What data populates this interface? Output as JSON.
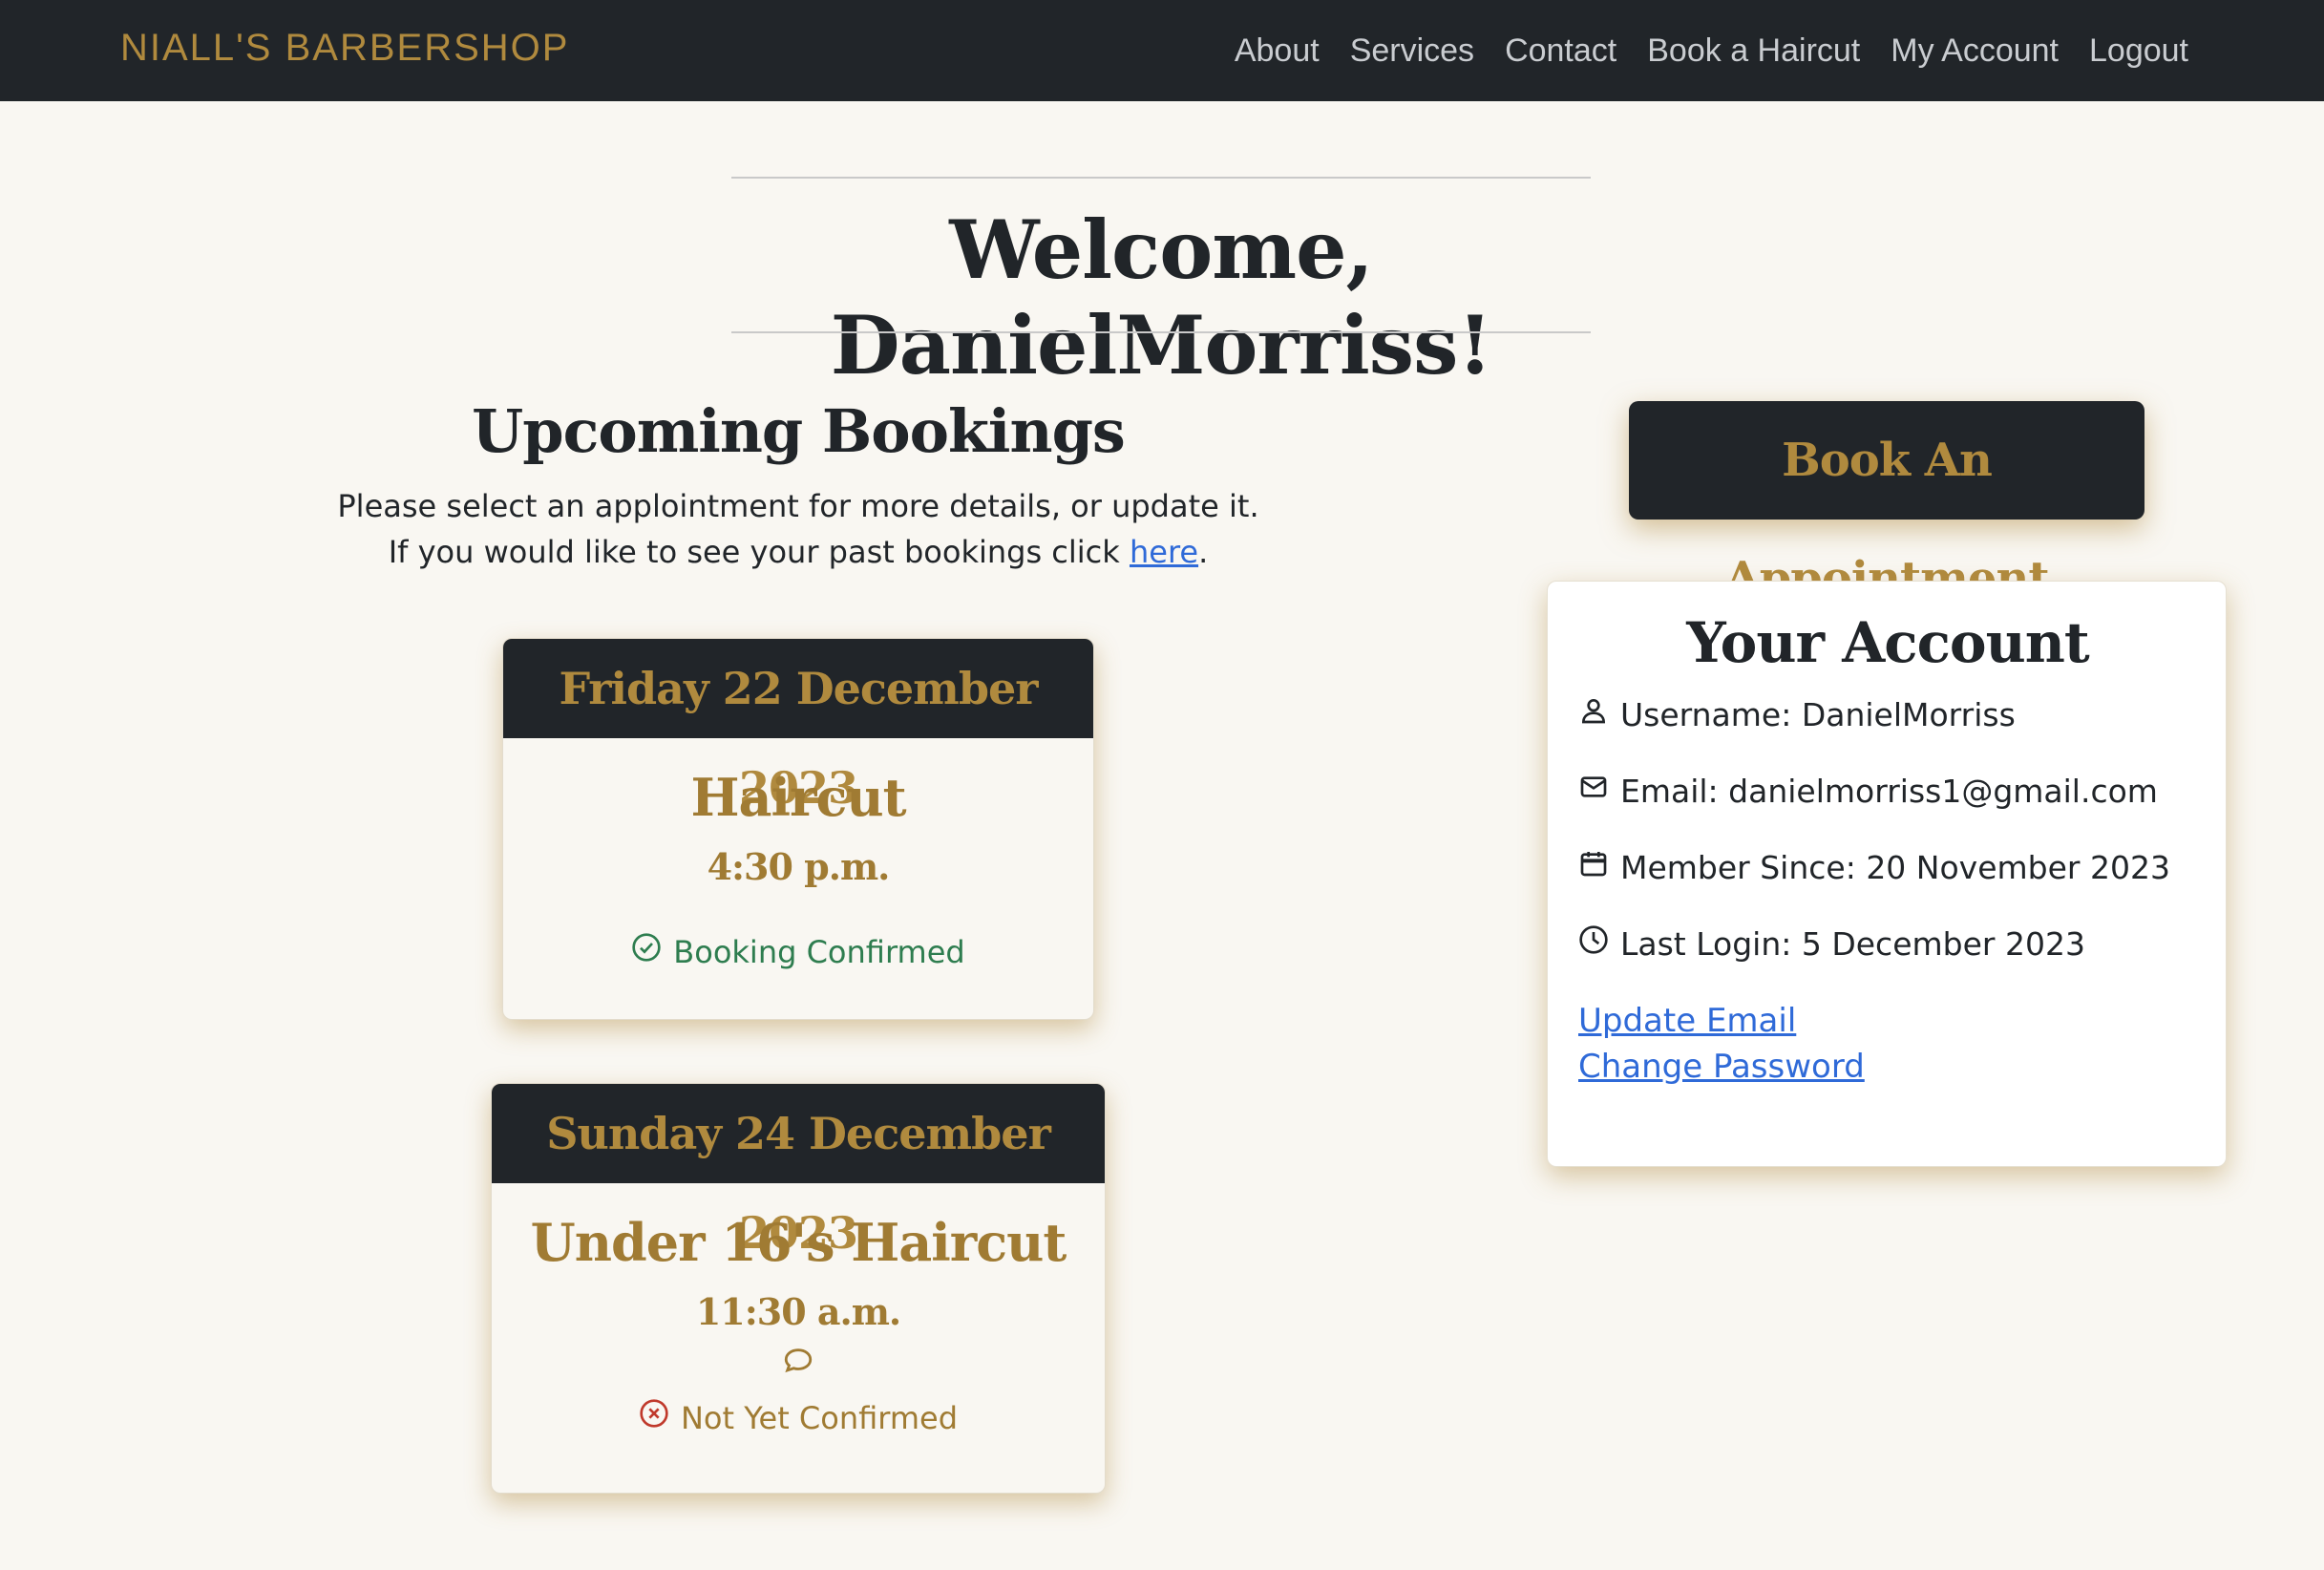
{
  "navbar": {
    "brand": "NIALL'S BARBERSHOP",
    "links": [
      "About",
      "Services",
      "Contact",
      "Book a Haircut",
      "My Account",
      "Logout"
    ]
  },
  "welcome": {
    "title": "Welcome, DanielMorriss!"
  },
  "bookings": {
    "title": "Upcoming Bookings",
    "intro_line1": "Please select an applointment for more details, or update it.",
    "intro_line2_prefix": "If you would like to see your past bookings click ",
    "intro_link": "here",
    "intro_line2_suffix": ".",
    "items": [
      {
        "date": "Friday 22 December 2023",
        "service": "Haircut",
        "time": "4:30 p.m.",
        "status": "Booking Confirmed",
        "has_comment": false
      },
      {
        "date": "Sunday 24 December 2023",
        "service": "Under 16's Haircut",
        "time": "11:30 a.m.",
        "status": "Not Yet Confirmed",
        "has_comment": true
      }
    ]
  },
  "cta": {
    "label": "Book An Appointment"
  },
  "account": {
    "title": "Your Account",
    "username": "Username: DanielMorriss",
    "email": "Email: danielmorriss1@gmail.com",
    "member_since": "Member Since: 20 November 2023",
    "last_login": "Last Login: 5 December 2023",
    "update_email": "Update Email",
    "change_password": "Change Password"
  },
  "colors": {
    "dark": "#212529",
    "gold": "#b08a3e",
    "background": "#f9f7f2",
    "confirmed": "#2e7d4f",
    "not_confirmed": "#c0392b",
    "link": "#2f6ad8"
  },
  "icons": [
    "check-circle-icon",
    "x-circle-icon",
    "chat-bubble-icon",
    "person-icon",
    "envelope-icon",
    "calendar-icon",
    "clock-icon"
  ]
}
